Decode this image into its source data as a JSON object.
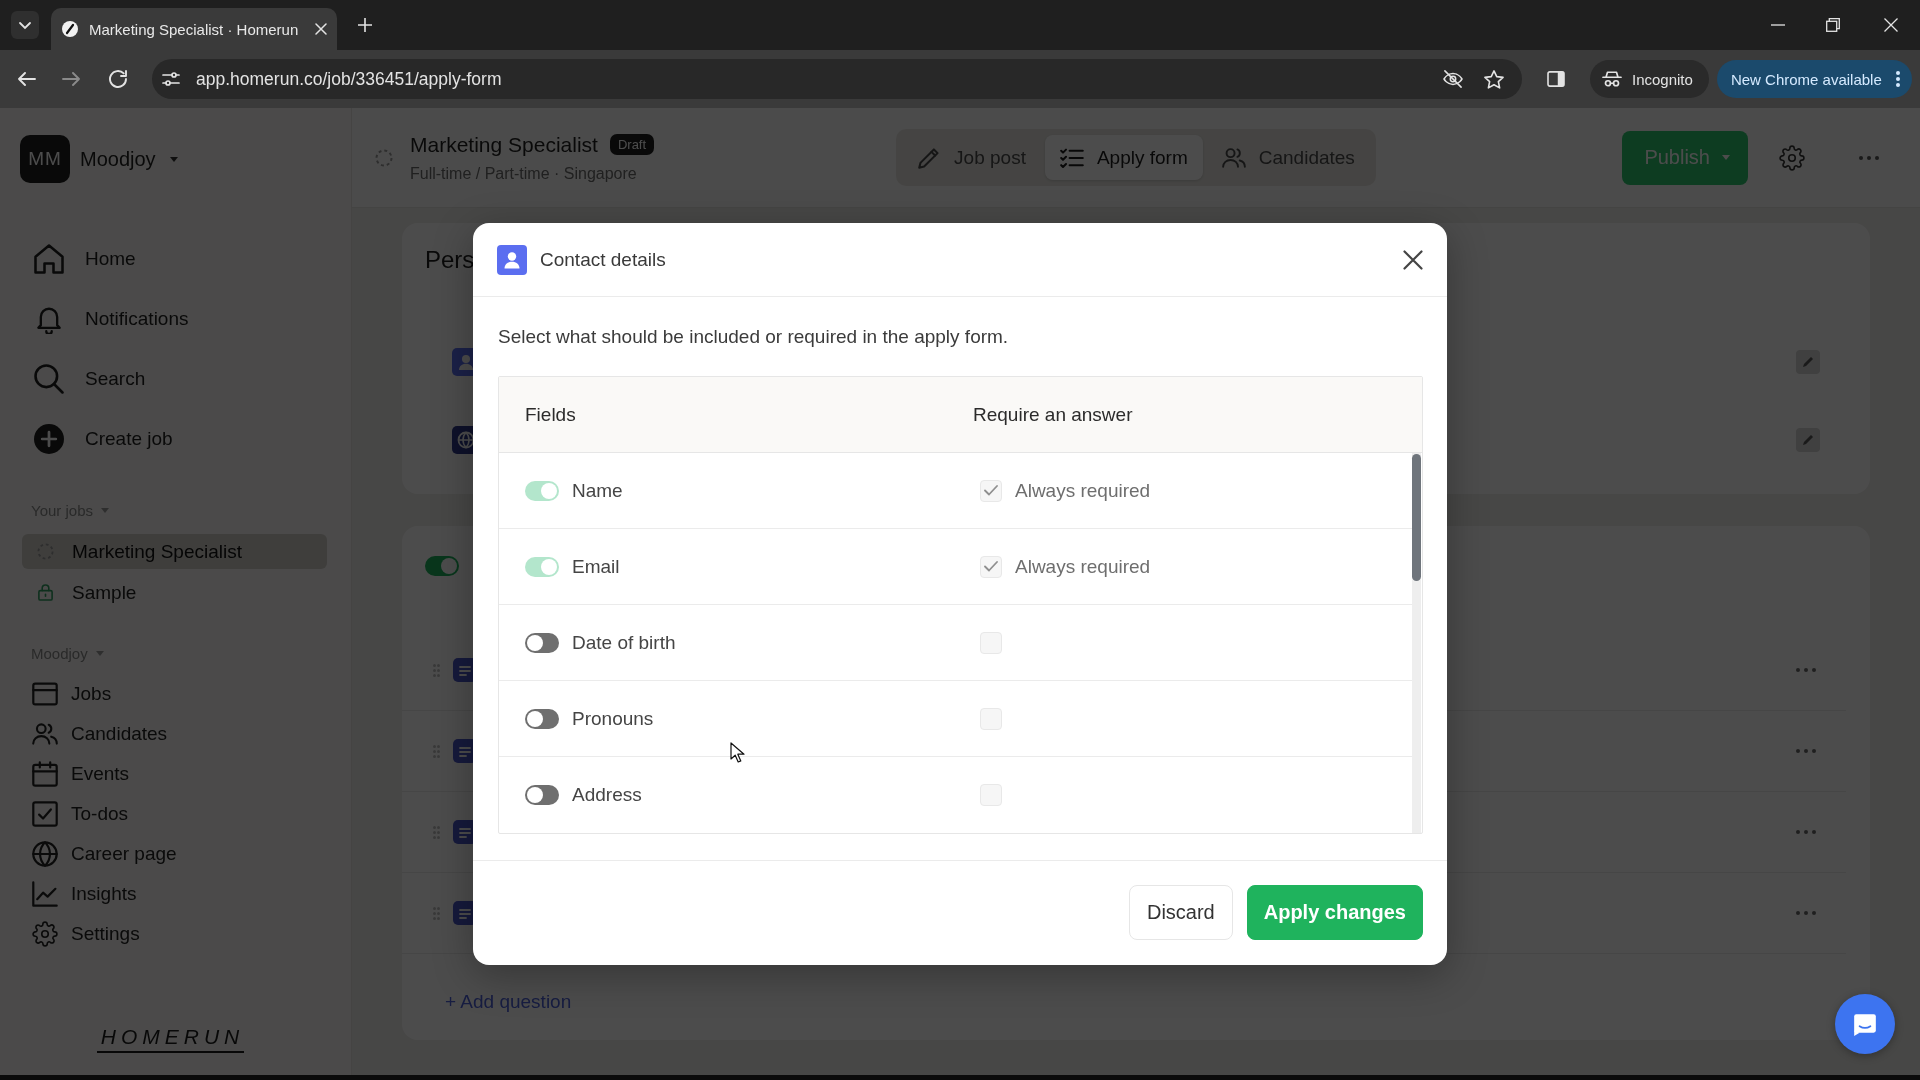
{
  "browser": {
    "tabs": [
      {
        "title": "Marketing Specialist · Homerun",
        "selected": true
      }
    ],
    "url": "app.homerun.co/job/336451/apply-form",
    "profile": "Incognito",
    "update_button": "New Chrome available"
  },
  "sidebar": {
    "workspace": {
      "initials": "MM",
      "name": "Moodjoy"
    },
    "nav": [
      {
        "label": "Home"
      },
      {
        "label": "Notifications"
      },
      {
        "label": "Search"
      },
      {
        "label": "Create job"
      }
    ],
    "your_jobs": {
      "title": "Your jobs",
      "items": [
        {
          "label": "Marketing Specialist",
          "selected": true
        },
        {
          "label": "Sample",
          "selected": false
        }
      ]
    },
    "company": {
      "title": "Moodjoy",
      "items": [
        {
          "label": "Jobs"
        },
        {
          "label": "Candidates"
        },
        {
          "label": "Events"
        },
        {
          "label": "To-dos"
        },
        {
          "label": "Career page"
        },
        {
          "label": "Insights"
        },
        {
          "label": "Settings"
        }
      ]
    },
    "logo": "HOMERUN"
  },
  "header": {
    "title": "Marketing Specialist",
    "badge": "Draft",
    "subtitle": "Full-time / Part-time · Singapore",
    "tabs": [
      {
        "label": "Job post",
        "selected": false
      },
      {
        "label": "Apply form",
        "selected": true
      },
      {
        "label": "Candidates",
        "selected": false
      }
    ],
    "publish_button": "Publish"
  },
  "form": {
    "section_title": "Pers",
    "section_rows": [
      {
        "kind": "contact"
      },
      {
        "kind": "web"
      }
    ],
    "questions_enabled": true,
    "questions": [
      {
        "kind": "question"
      },
      {
        "kind": "question"
      },
      {
        "kind": "question"
      },
      {
        "kind": "question"
      }
    ],
    "add_question": "+ Add question"
  },
  "modal": {
    "title": "Contact details",
    "description": "Select what should be included or required in the apply form.",
    "columns": [
      "Fields",
      "Require an answer"
    ],
    "fields": [
      {
        "label": "Name",
        "included": true,
        "locked": true,
        "required": true,
        "note": "Always required"
      },
      {
        "label": "Email",
        "included": true,
        "locked": true,
        "required": true,
        "note": "Always required"
      },
      {
        "label": "Date of birth",
        "included": false,
        "locked": false,
        "required": false
      },
      {
        "label": "Pronouns",
        "included": false,
        "locked": false,
        "required": false
      },
      {
        "label": "Address",
        "included": false,
        "locked": false,
        "required": false
      }
    ],
    "buttons": [
      {
        "label": "Discard",
        "kind": "secondary"
      },
      {
        "label": "Apply changes",
        "kind": "primary"
      }
    ]
  }
}
